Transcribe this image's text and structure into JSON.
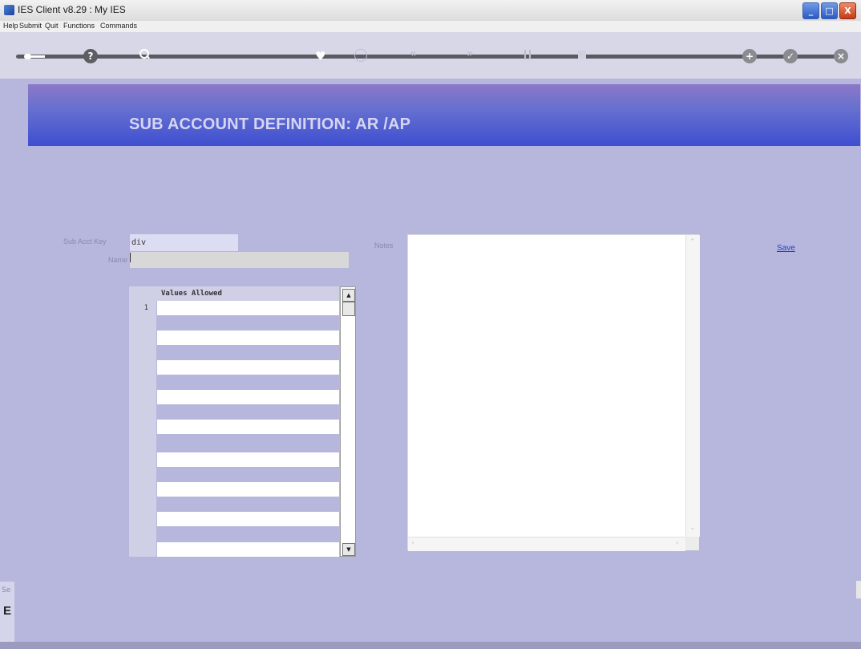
{
  "window": {
    "title": "IES Client v8.29 : My IES",
    "buttons": {
      "minimize": "_",
      "maximize": "□",
      "close": "X"
    }
  },
  "menu": {
    "items": [
      "Help",
      "Submit",
      "Quit",
      "Functions",
      "Commands"
    ]
  },
  "toolbar": {
    "icons": [
      "key-icon",
      "help-icon",
      "search-icon",
      "heart-icon",
      "clock-icon",
      "previous-icon",
      "next-icon",
      "pause-icon",
      "stop-icon",
      "add-icon",
      "check-icon",
      "close-icon"
    ]
  },
  "form": {
    "title": "SUB ACCOUNT DEFINITION: AR /AP",
    "sub_acct_key_label": "Sub Acct Key",
    "sub_acct_key_value": "div",
    "name_label": "Name",
    "name_value": "",
    "notes_label": "Notes",
    "notes_value": "",
    "save_label": "Save"
  },
  "grid": {
    "column_header": "Values Allowed",
    "row_numbers": [
      "1"
    ],
    "rows": [
      "",
      "",
      "",
      "",
      "",
      "",
      "",
      "",
      ""
    ]
  },
  "side": {
    "fragment_label": "Se",
    "fragment_letter": "E"
  },
  "colors": {
    "background": "#b7b7dd",
    "header_gradient_top": "#8d78c6",
    "header_gradient_bottom": "#3e4fd0",
    "link": "#1f3fcf"
  }
}
